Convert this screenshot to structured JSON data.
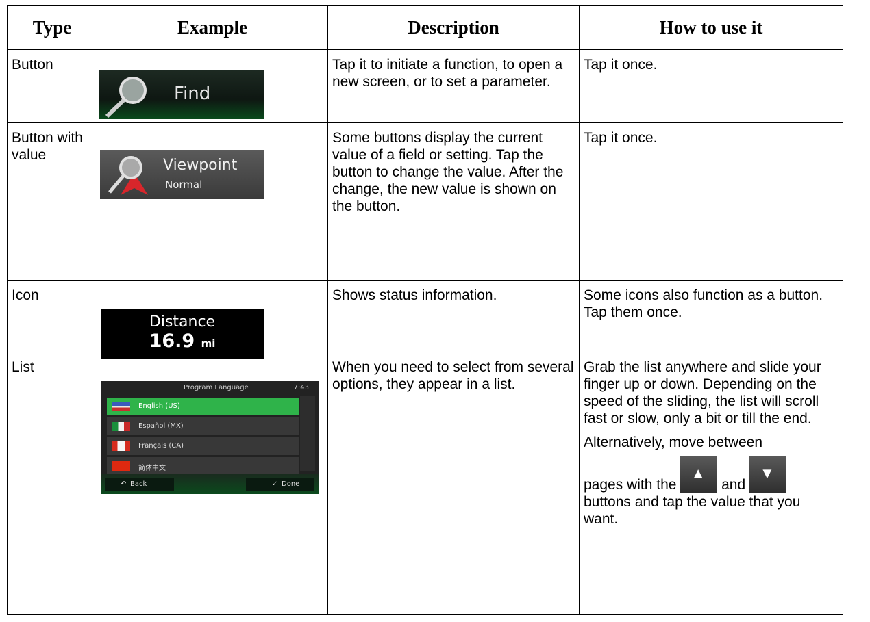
{
  "headers": {
    "type": "Type",
    "example": "Example",
    "description": "Description",
    "how": "How to use it"
  },
  "rows": {
    "button": {
      "type": "Button",
      "example_label": "Find",
      "description": "Tap it to initiate a function, to open a new screen, or to set a parameter.",
      "how": "Tap it once."
    },
    "button_value": {
      "type": "Button with value",
      "example_label": "Viewpoint",
      "example_value": "Normal",
      "description": "Some buttons display the current value of a field or setting. Tap the button to change the value. After the change, the new value is shown on the button.",
      "how": "Tap it once."
    },
    "icon": {
      "type": "Icon",
      "example_label": "Distance",
      "example_value": "16.9",
      "example_unit": "mi",
      "description": "Shows status information.",
      "how": "Some icons also function as a button. Tap them once."
    },
    "list": {
      "type": "List",
      "example_title": "Program Language",
      "example_time": "7:43",
      "example_items": [
        "English (US)",
        "Español (MX)",
        "Français (CA)",
        "简体中文"
      ],
      "example_back": "Back",
      "example_done": "Done",
      "description": "When you need to select from several options, they appear in a list.",
      "how_1": "Grab the list anywhere and slide your finger up or down. Depending on the speed of the sliding, the list will scroll fast or slow, only a bit or till the end.",
      "how_2a": "Alternatively, move between",
      "how_2b": "pages with the",
      "how_2c": "and",
      "how_2d": "buttons and tap the value that you want."
    }
  },
  "colors": {
    "highlight": "#2fb34a",
    "flag_us": "#3b5bbd",
    "flag_mx": "#1a8f3c",
    "flag_ca": "#d52b1e",
    "flag_cn": "#de2910"
  },
  "icons": {
    "search": "magnifier-icon",
    "up": "arrow-up-icon",
    "down": "arrow-down-icon"
  }
}
